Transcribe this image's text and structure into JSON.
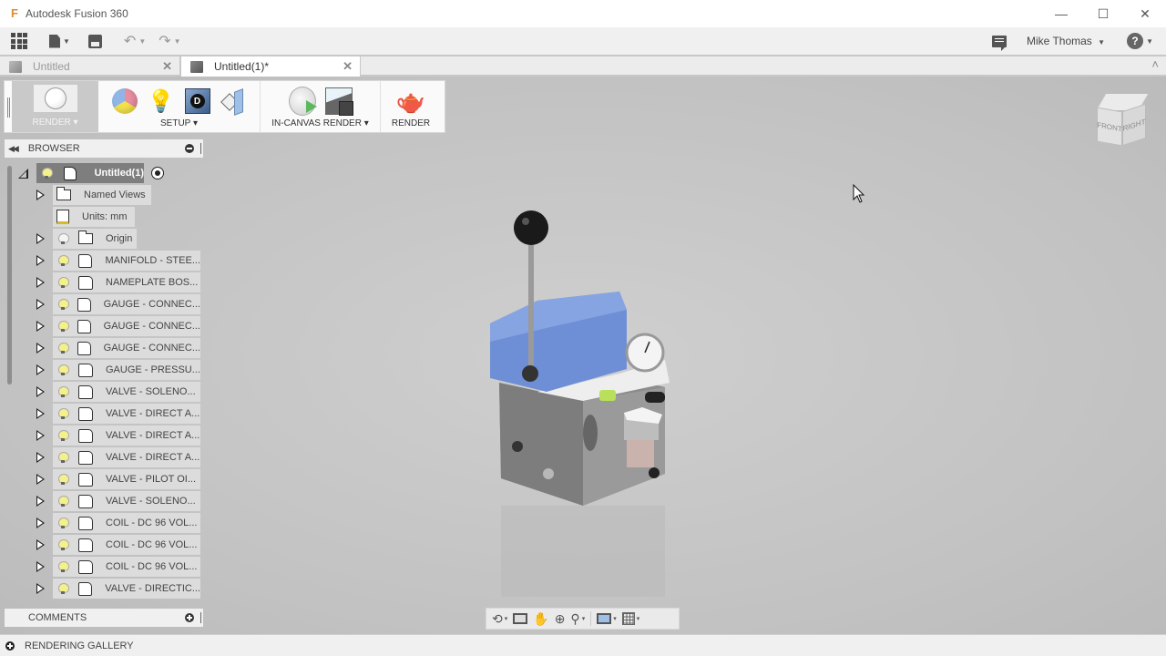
{
  "app": {
    "title": "Autodesk Fusion 360",
    "logo_glyph": "F"
  },
  "window_controls": {
    "minimize": "—",
    "maximize": "☐",
    "close": "✕"
  },
  "quick_access": {
    "icons": [
      "grid-apps-icon",
      "file-icon",
      "save-icon",
      "undo-icon",
      "redo-icon"
    ],
    "undo_glyph": "↶",
    "redo_glyph": "↷",
    "caret": "▼"
  },
  "user": {
    "name": "Mike Thomas",
    "help_glyph": "?"
  },
  "tabs": [
    {
      "label": "Untitled",
      "active": false,
      "close": "✕"
    },
    {
      "label": "Untitled(1)*",
      "active": true,
      "close": "✕"
    }
  ],
  "collapse_glyph": "˄",
  "ribbon": {
    "workspace": "RENDER ▾",
    "groups": [
      {
        "label": "SETUP ▾",
        "tools": [
          "appearance",
          "scene-settings",
          "texture-map",
          "section-analysis"
        ]
      },
      {
        "label": "IN-CANVAS RENDER ▾",
        "tools": [
          "in-canvas-render",
          "capture-image"
        ]
      },
      {
        "label": "RENDER",
        "tools": [
          "render"
        ]
      }
    ],
    "lamp_glyph": "💡",
    "teapot_glyph": "🫖",
    "decal_glyph": "D"
  },
  "browser": {
    "title": "BROWSER",
    "collapse_glyph": "◀◀",
    "root": {
      "label": "Untitled(1)"
    },
    "items": [
      {
        "label": "Named Views",
        "type": "folder",
        "bulb": false,
        "expandable": true
      },
      {
        "label": "Units: mm",
        "type": "units",
        "bulb": false,
        "expandable": false
      },
      {
        "label": "Origin",
        "type": "folder",
        "bulb": "off",
        "expandable": true
      },
      {
        "label": "MANIFOLD - STEE...",
        "type": "component",
        "bulb": "on",
        "expandable": true
      },
      {
        "label": "NAMEPLATE BOS...",
        "type": "component",
        "bulb": "on",
        "expandable": true
      },
      {
        "label": "GAUGE - CONNEC...",
        "type": "component",
        "bulb": "on",
        "expandable": true
      },
      {
        "label": "GAUGE - CONNEC...",
        "type": "component",
        "bulb": "on",
        "expandable": true
      },
      {
        "label": "GAUGE - CONNEC...",
        "type": "component",
        "bulb": "on",
        "expandable": true
      },
      {
        "label": "GAUGE - PRESSU...",
        "type": "component",
        "bulb": "on",
        "expandable": true
      },
      {
        "label": "VALVE - SOLENO...",
        "type": "component",
        "bulb": "on",
        "expandable": true
      },
      {
        "label": "VALVE - DIRECT A...",
        "type": "component",
        "bulb": "on",
        "expandable": true
      },
      {
        "label": "VALVE - DIRECT A...",
        "type": "component",
        "bulb": "on",
        "expandable": true
      },
      {
        "label": "VALVE - DIRECT A...",
        "type": "component",
        "bulb": "on",
        "expandable": true
      },
      {
        "label": "VALVE - PILOT OI...",
        "type": "component",
        "bulb": "on",
        "expandable": true
      },
      {
        "label": "VALVE - SOLENO...",
        "type": "component",
        "bulb": "on",
        "expandable": true
      },
      {
        "label": "COIL - DC 96 VOL...",
        "type": "component",
        "bulb": "on",
        "expandable": true
      },
      {
        "label": "COIL - DC 96 VOL...",
        "type": "component",
        "bulb": "on",
        "expandable": true
      },
      {
        "label": "COIL - DC 96 VOL...",
        "type": "component",
        "bulb": "on",
        "expandable": true
      },
      {
        "label": "VALVE - DIRECTIC...",
        "type": "component",
        "bulb": "on",
        "expandable": true
      }
    ]
  },
  "comments": {
    "title": "COMMENTS"
  },
  "rendering_gallery": {
    "label": "RENDERING GALLERY"
  },
  "viewcube": {
    "front": "FRONT",
    "right": "RIGHT"
  },
  "nav_toolbar": {
    "tools": [
      "orbit",
      "look-at",
      "pan",
      "zoom",
      "fit",
      "display-settings",
      "grid-settings"
    ],
    "orbit_glyph": "⟲",
    "pan_glyph": "✋",
    "zoom_glyph": "⊕",
    "fit_glyph": "⚲",
    "caret": "▾"
  },
  "colors": {
    "accent_blue": "#6e8fd6",
    "canvas_bg": "#c4c4c4",
    "root_node_bg": "#7e7e7e",
    "bulb_on": "#f4f08a"
  }
}
